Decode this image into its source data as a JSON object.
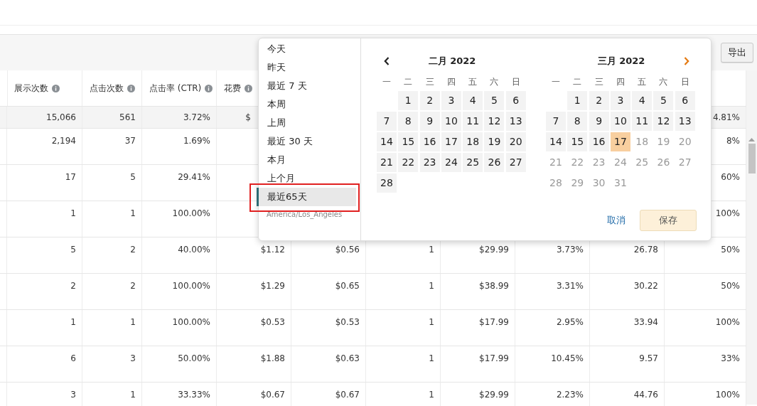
{
  "toolbar": {
    "export_button": "导出"
  },
  "table": {
    "header": {
      "impressions": "展示次数",
      "clicks": "点击次数",
      "ctr": "点击率 (CTR)",
      "spend": "花费"
    },
    "totals": {
      "impressions": "15,066",
      "clicks": "561",
      "ctr": "3.72%",
      "spend": "$",
      "column_11": "4.81%"
    },
    "rows": [
      {
        "impressions": "2,194",
        "clicks": "37",
        "ctr": "1.69%",
        "column_11": "8%"
      },
      {
        "impressions": "17",
        "clicks": "5",
        "ctr": "29.41%",
        "column_11": "60%"
      },
      {
        "impressions": "1",
        "clicks": "1",
        "ctr": "100.00%",
        "column_11": "100%"
      },
      {
        "impressions": "5",
        "clicks": "2",
        "ctr": "40.00%",
        "spend": "$1.12",
        "column_6": "$0.56",
        "column_7": "1",
        "column_8": "$29.99",
        "column_9": "3.73%",
        "column_10": "26.78",
        "column_11": "50%"
      },
      {
        "impressions": "2",
        "clicks": "2",
        "ctr": "100.00%",
        "spend": "$1.29",
        "column_6": "$0.65",
        "column_7": "1",
        "column_8": "$38.99",
        "column_9": "3.31%",
        "column_10": "30.22",
        "column_11": "50%"
      },
      {
        "impressions": "1",
        "clicks": "1",
        "ctr": "100.00%",
        "spend": "$0.53",
        "column_6": "$0.53",
        "column_7": "1",
        "column_8": "$17.99",
        "column_9": "2.95%",
        "column_10": "33.94",
        "column_11": "100%"
      },
      {
        "impressions": "6",
        "clicks": "3",
        "ctr": "50.00%",
        "spend": "$1.88",
        "column_6": "$0.63",
        "column_7": "1",
        "column_8": "$17.99",
        "column_9": "10.45%",
        "column_10": "9.57",
        "column_11": "33%"
      },
      {
        "impressions": "3",
        "clicks": "1",
        "ctr": "33.33%",
        "spend": "$0.67",
        "column_6": "$0.67",
        "column_7": "1",
        "column_8": "$29.99",
        "column_9": "2.23%",
        "column_10": "44.76",
        "column_11": "100%"
      }
    ]
  },
  "date_picker": {
    "presets": [
      {
        "label": "今天",
        "selected": false
      },
      {
        "label": "昨天",
        "selected": false
      },
      {
        "label": "最近 7 天",
        "selected": false
      },
      {
        "label": "本周",
        "selected": false
      },
      {
        "label": "上周",
        "selected": false
      },
      {
        "label": "最近 30 天",
        "selected": false
      },
      {
        "label": "本月",
        "selected": false
      },
      {
        "label": "上个月",
        "selected": false
      },
      {
        "label": "最近65天",
        "selected": true
      }
    ],
    "timezone": "America/Los_Angeles",
    "months": [
      {
        "title": "二月 2022",
        "weekdays": [
          "一",
          "二",
          "三",
          "四",
          "五",
          "六",
          "日"
        ],
        "weeks": [
          [
            {
              "kind": "blank"
            },
            {
              "label": "1",
              "in_range": true,
              "selected": false,
              "disabled": false
            },
            {
              "label": "2",
              "in_range": true,
              "selected": false,
              "disabled": false
            },
            {
              "label": "3",
              "in_range": true,
              "selected": false,
              "disabled": false
            },
            {
              "label": "4",
              "in_range": true,
              "selected": false,
              "disabled": false
            },
            {
              "label": "5",
              "in_range": true,
              "selected": false,
              "disabled": false
            },
            {
              "label": "6",
              "in_range": true,
              "selected": false,
              "disabled": false
            }
          ],
          [
            {
              "label": "7",
              "in_range": true,
              "selected": false,
              "disabled": false
            },
            {
              "label": "8",
              "in_range": true,
              "selected": false,
              "disabled": false
            },
            {
              "label": "9",
              "in_range": true,
              "selected": false,
              "disabled": false
            },
            {
              "label": "10",
              "in_range": true,
              "selected": false,
              "disabled": false
            },
            {
              "label": "11",
              "in_range": true,
              "selected": false,
              "disabled": false
            },
            {
              "label": "12",
              "in_range": true,
              "selected": false,
              "disabled": false
            },
            {
              "label": "13",
              "in_range": true,
              "selected": false,
              "disabled": false
            }
          ],
          [
            {
              "label": "14",
              "in_range": true,
              "selected": false,
              "disabled": false
            },
            {
              "label": "15",
              "in_range": true,
              "selected": false,
              "disabled": false
            },
            {
              "label": "16",
              "in_range": true,
              "selected": false,
              "disabled": false
            },
            {
              "label": "17",
              "in_range": true,
              "selected": false,
              "disabled": false
            },
            {
              "label": "18",
              "in_range": true,
              "selected": false,
              "disabled": false
            },
            {
              "label": "19",
              "in_range": true,
              "selected": false,
              "disabled": false
            },
            {
              "label": "20",
              "in_range": true,
              "selected": false,
              "disabled": false
            }
          ],
          [
            {
              "label": "21",
              "in_range": true,
              "selected": false,
              "disabled": false
            },
            {
              "label": "22",
              "in_range": true,
              "selected": false,
              "disabled": false
            },
            {
              "label": "23",
              "in_range": true,
              "selected": false,
              "disabled": false
            },
            {
              "label": "24",
              "in_range": true,
              "selected": false,
              "disabled": false
            },
            {
              "label": "25",
              "in_range": true,
              "selected": false,
              "disabled": false
            },
            {
              "label": "26",
              "in_range": true,
              "selected": false,
              "disabled": false
            },
            {
              "label": "27",
              "in_range": true,
              "selected": false,
              "disabled": false
            }
          ],
          [
            {
              "label": "28",
              "in_range": true,
              "selected": false,
              "disabled": false
            }
          ]
        ]
      },
      {
        "title": "三月 2022",
        "weekdays": [
          "一",
          "二",
          "三",
          "四",
          "五",
          "六",
          "日"
        ],
        "weeks": [
          [
            {
              "kind": "blank"
            },
            {
              "label": "1",
              "in_range": true,
              "selected": false,
              "disabled": false
            },
            {
              "label": "2",
              "in_range": true,
              "selected": false,
              "disabled": false
            },
            {
              "label": "3",
              "in_range": true,
              "selected": false,
              "disabled": false
            },
            {
              "label": "4",
              "in_range": true,
              "selected": false,
              "disabled": false
            },
            {
              "label": "5",
              "in_range": true,
              "selected": false,
              "disabled": false
            },
            {
              "label": "6",
              "in_range": true,
              "selected": false,
              "disabled": false
            }
          ],
          [
            {
              "label": "7",
              "in_range": true,
              "selected": false,
              "disabled": false
            },
            {
              "label": "8",
              "in_range": true,
              "selected": false,
              "disabled": false
            },
            {
              "label": "9",
              "in_range": true,
              "selected": false,
              "disabled": false
            },
            {
              "label": "10",
              "in_range": true,
              "selected": false,
              "disabled": false
            },
            {
              "label": "11",
              "in_range": true,
              "selected": false,
              "disabled": false
            },
            {
              "label": "12",
              "in_range": true,
              "selected": false,
              "disabled": false
            },
            {
              "label": "13",
              "in_range": true,
              "selected": false,
              "disabled": false
            }
          ],
          [
            {
              "label": "14",
              "in_range": true,
              "selected": false,
              "disabled": false
            },
            {
              "label": "15",
              "in_range": true,
              "selected": false,
              "disabled": false
            },
            {
              "label": "16",
              "in_range": true,
              "selected": false,
              "disabled": false
            },
            {
              "label": "17",
              "in_range": false,
              "selected": true,
              "disabled": false
            },
            {
              "label": "18",
              "in_range": false,
              "selected": false,
              "disabled": true
            },
            {
              "label": "19",
              "in_range": false,
              "selected": false,
              "disabled": true
            },
            {
              "label": "20",
              "in_range": false,
              "selected": false,
              "disabled": true
            }
          ],
          [
            {
              "label": "21",
              "in_range": false,
              "selected": false,
              "disabled": true
            },
            {
              "label": "22",
              "in_range": false,
              "selected": false,
              "disabled": true
            },
            {
              "label": "23",
              "in_range": false,
              "selected": false,
              "disabled": true
            },
            {
              "label": "24",
              "in_range": false,
              "selected": false,
              "disabled": true
            },
            {
              "label": "25",
              "in_range": false,
              "selected": false,
              "disabled": true
            },
            {
              "label": "26",
              "in_range": false,
              "selected": false,
              "disabled": true
            },
            {
              "label": "27",
              "in_range": false,
              "selected": false,
              "disabled": true
            }
          ],
          [
            {
              "label": "28",
              "in_range": false,
              "selected": false,
              "disabled": true
            },
            {
              "label": "29",
              "in_range": false,
              "selected": false,
              "disabled": true
            },
            {
              "label": "30",
              "in_range": false,
              "selected": false,
              "disabled": true
            },
            {
              "label": "31",
              "in_range": false,
              "selected": false,
              "disabled": true
            }
          ]
        ]
      }
    ],
    "cancel_button": "取消",
    "save_button": "保存"
  }
}
